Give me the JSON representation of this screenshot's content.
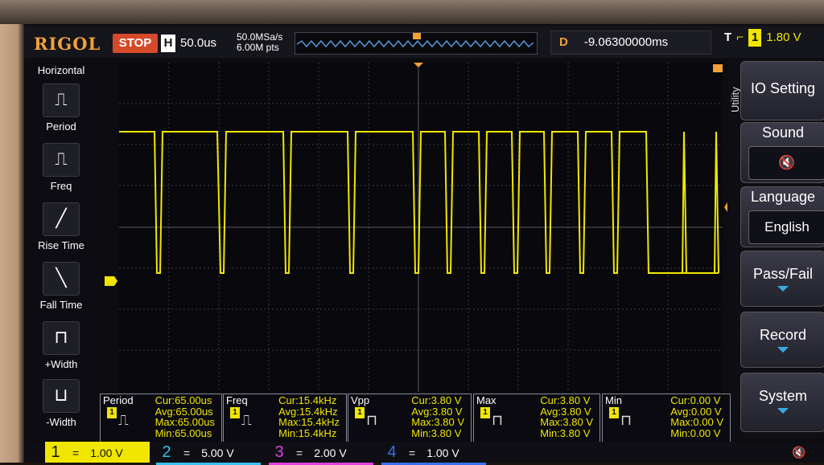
{
  "header": {
    "brand": "RIGOL",
    "run_state": "STOP",
    "timebase_label": "H",
    "timebase_value": "50.0us",
    "sample_rate": "50.0MSa/s",
    "memory_depth": "6.00M pts",
    "delay_label": "D",
    "delay_value": "-9.06300000ms",
    "trigger_label": "T",
    "trigger_channel": "1",
    "trigger_level": "1.80 V"
  },
  "left_menu": {
    "title": "Horizontal",
    "items": [
      {
        "label": "Period",
        "icon": "period-icon"
      },
      {
        "label": "Freq",
        "icon": "frequency-icon"
      },
      {
        "label": "Rise Time",
        "icon": "rise-time-icon"
      },
      {
        "label": "Fall Time",
        "icon": "fall-time-icon"
      },
      {
        "label": "+Width",
        "icon": "positive-width-icon"
      },
      {
        "label": "-Width",
        "icon": "negative-width-icon"
      }
    ]
  },
  "right_menu": {
    "section": "Utility",
    "items": [
      {
        "label": "IO Setting"
      },
      {
        "label": "Sound",
        "sub": "speaker-muted-icon"
      },
      {
        "label": "Language",
        "sub_value": "English"
      },
      {
        "label": "Pass/Fail"
      },
      {
        "label": "Record"
      },
      {
        "label": "System"
      }
    ]
  },
  "measurements": [
    {
      "title": "Period",
      "cur": "Cur:65.00us",
      "avg": "Avg:65.00us",
      "max": "Max:65.00us",
      "min": "Min:65.00us"
    },
    {
      "title": "Freq",
      "cur": "Cur:15.4kHz",
      "avg": "Avg:15.4kHz",
      "max": "Max:15.4kHz",
      "min": "Min:15.4kHz"
    },
    {
      "title": "Vpp",
      "cur": "Cur:3.80 V",
      "avg": "Avg:3.80 V",
      "max": "Max:3.80 V",
      "min": "Min:3.80 V"
    },
    {
      "title": "Max",
      "cur": "Cur:3.80 V",
      "avg": "Avg:3.80 V",
      "max": "Max:3.80 V",
      "min": "Min:3.80 V"
    },
    {
      "title": "Min",
      "cur": "Cur:0.00 V",
      "avg": "Avg:0.00 V",
      "max": "Max:0.00 V",
      "min": "Min:0.00 V"
    }
  ],
  "channels": [
    {
      "num": "1",
      "coupling": "=",
      "scale": "1.00 V",
      "color": "#f0e600"
    },
    {
      "num": "2",
      "coupling": "=",
      "scale": "5.00 V",
      "color": "#39c0f0"
    },
    {
      "num": "3",
      "coupling": "=",
      "scale": "2.00 V",
      "color": "#e040e0"
    },
    {
      "num": "4",
      "coupling": "=",
      "scale": "1.00 V",
      "color": "#3a6ef0"
    }
  ],
  "colors": {
    "ch1": "#f0e600",
    "accent": "#f0a13a",
    "stop": "#d64a2a",
    "menu_arrow": "#39a9e0"
  }
}
